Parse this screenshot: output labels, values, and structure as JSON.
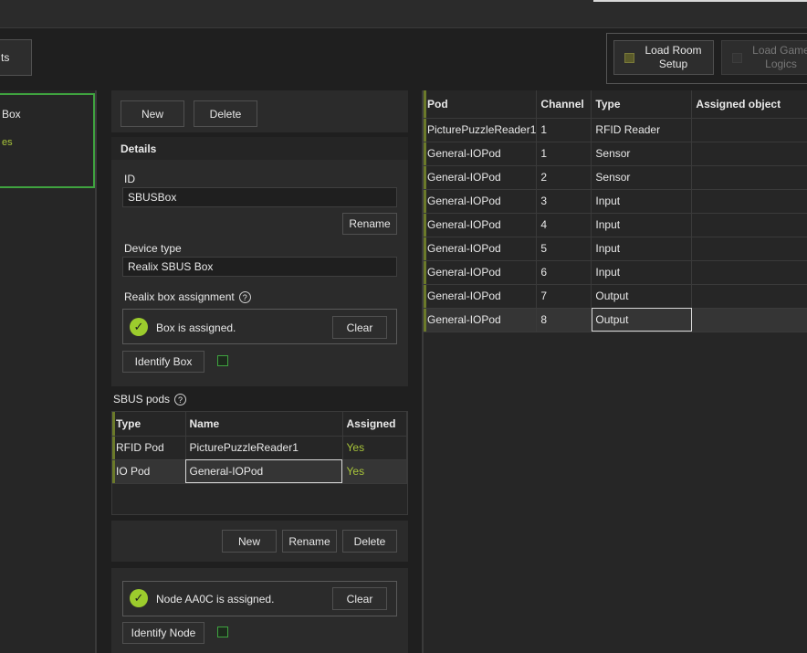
{
  "toolbar": {
    "cut_button_label": "ts",
    "load_room_setup_label": "Load Room Setup",
    "load_game_logics_label": "Load Game Logics"
  },
  "left_panel": {
    "item_title": "Box",
    "item_subtitle": "es"
  },
  "device_actions": {
    "new_label": "New",
    "delete_label": "Delete"
  },
  "details": {
    "header": "Details",
    "id_label": "ID",
    "id_value": "SBUSBox",
    "rename_label": "Rename",
    "device_type_label": "Device type",
    "device_type_value": "Realix SBUS Box",
    "box_assignment_label": "Realix box assignment",
    "help_glyph": "?",
    "box_status": "Box is assigned.",
    "clear_label": "Clear",
    "identify_box_label": "Identify Box"
  },
  "sbus_pods": {
    "label": "SBUS pods",
    "columns": [
      "Type",
      "Name",
      "Assigned"
    ],
    "rows": [
      {
        "type": "RFID Pod",
        "name": "PicturePuzzleReader1",
        "assigned": "Yes"
      },
      {
        "type": "IO Pod",
        "name": "General-IOPod",
        "assigned": "Yes"
      }
    ],
    "new_label": "New",
    "rename_label": "Rename",
    "delete_label": "Delete"
  },
  "node": {
    "status": "Node AA0C is assigned.",
    "clear_label": "Clear",
    "identify_node_label": "Identify Node"
  },
  "pod_channels": {
    "columns": [
      "Pod",
      "Channel",
      "Type",
      "Assigned object"
    ],
    "rows": [
      {
        "pod": "PicturePuzzleReader1",
        "channel": "1",
        "type": "RFID Reader",
        "assigned": ""
      },
      {
        "pod": "General-IOPod",
        "channel": "1",
        "type": "Sensor",
        "assigned": ""
      },
      {
        "pod": "General-IOPod",
        "channel": "2",
        "type": "Sensor",
        "assigned": ""
      },
      {
        "pod": "General-IOPod",
        "channel": "3",
        "type": "Input",
        "assigned": ""
      },
      {
        "pod": "General-IOPod",
        "channel": "4",
        "type": "Input",
        "assigned": ""
      },
      {
        "pod": "General-IOPod",
        "channel": "5",
        "type": "Input",
        "assigned": ""
      },
      {
        "pod": "General-IOPod",
        "channel": "6",
        "type": "Input",
        "assigned": ""
      },
      {
        "pod": "General-IOPod",
        "channel": "7",
        "type": "Output",
        "assigned": ""
      },
      {
        "pod": "General-IOPod",
        "channel": "8",
        "type": "Output",
        "assigned": ""
      }
    ]
  },
  "colors": {
    "accent_green": "#3fa33f",
    "assigned_yellow": "#a8c43a",
    "check_green": "#9ccc2d",
    "background": "#1f1f1f"
  }
}
